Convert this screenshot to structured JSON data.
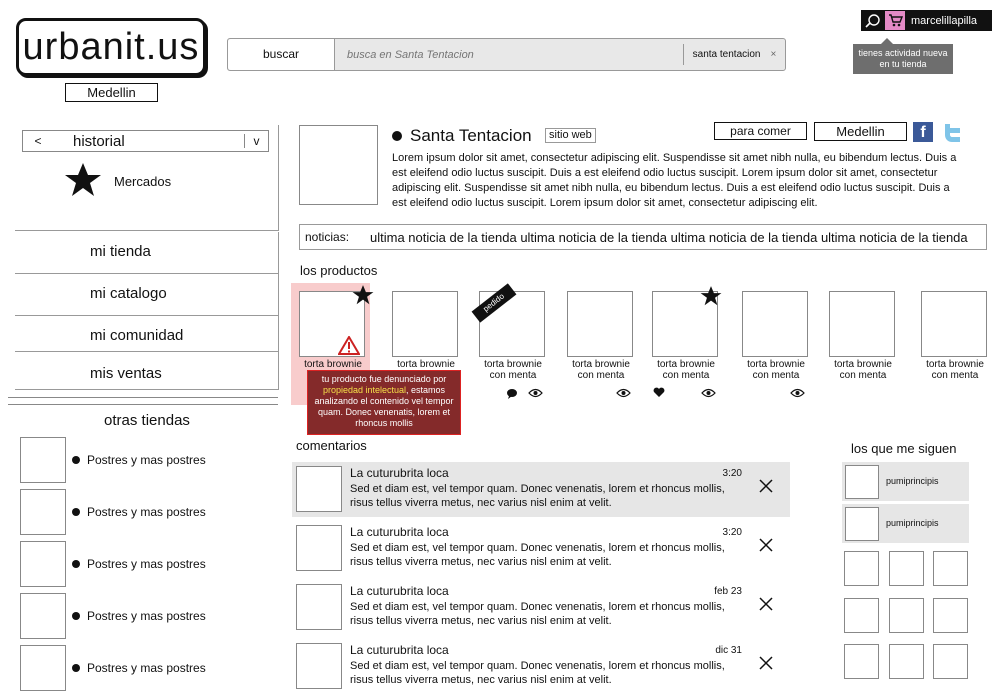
{
  "brand": {
    "logo_text": "urbanit.us",
    "city": "Medellin"
  },
  "search": {
    "button_label": "buscar",
    "placeholder": "busca en Santa Tentacion",
    "scope": "santa tentacion",
    "clear": "×"
  },
  "user": {
    "name": "marcelillapilla",
    "activity_tooltip": "tienes actividad nueva en tu tienda",
    "icons": [
      "chat-icon",
      "cart-icon"
    ]
  },
  "sidebar": {
    "history": {
      "prev": "<",
      "label": "historial",
      "next": "v"
    },
    "featured": {
      "icon": "star-icon",
      "label": "Mercados"
    },
    "nav": [
      "mi tienda",
      "mi catalogo",
      "mi comunidad",
      "mis ventas"
    ],
    "other_stores_title": "otras tiendas",
    "other_stores": [
      "Postres y mas postres",
      "Postres y mas postres",
      "Postres y mas postres",
      "Postres y mas postres",
      "Postres y mas postres"
    ]
  },
  "store": {
    "name": "Santa Tentacion",
    "website_label": "sitio web",
    "category": "para comer",
    "city": "Medellin",
    "social": [
      "facebook-icon",
      "twitter-icon"
    ],
    "description": "Lorem ipsum dolor sit amet, consectetur adipiscing elit. Suspendisse sit amet nibh nulla, eu bibendum lectus. Duis a est eleifend odio luctus suscipit. Duis a est eleifend odio luctus suscipit. Lorem ipsum dolor sit amet, consectetur adipiscing elit. Suspendisse sit amet nibh nulla, eu bibendum lectus. Duis a est eleifend odio luctus suscipit. Duis a est eleifend odio luctus suscipit. Lorem ipsum dolor sit amet, consectetur adipiscing elit."
  },
  "news": {
    "label": "noticias:",
    "text": "ultima noticia de la tienda ultima noticia de la tienda ultima noticia de la tienda ultima noticia de la tienda"
  },
  "products": {
    "title": "los productos",
    "pedido_badge": "pedido",
    "warning": {
      "pre": "tu producto fue denunciado por ",
      "highlight": "propiedad intelectual",
      "post": ", estamos analizando el contenido vel tempor quam. Donec venenatis, lorem et rhoncus mollis"
    },
    "items": [
      {
        "name": "torta brownie con menta",
        "starred": true,
        "flagged": true
      },
      {
        "name": "torta brownie con menta",
        "icons": [
          "comment-icon",
          "eye-icon"
        ]
      },
      {
        "name": "torta brownie con menta",
        "pedido": true,
        "icons": [
          "eye-icon"
        ]
      },
      {
        "name": "torta brownie con menta"
      },
      {
        "name": "torta brownie con menta",
        "starred": true,
        "icons": [
          "heart-icon",
          "eye-icon"
        ]
      },
      {
        "name": "torta brownie con menta",
        "icons": [
          "eye-icon"
        ]
      },
      {
        "name": "torta brownie con menta"
      },
      {
        "name": "torta brownie con menta"
      }
    ]
  },
  "comments": {
    "title": "comentarios",
    "items": [
      {
        "author": "La cuturubrita loca",
        "time": "3:20",
        "text": "Sed et diam est, vel tempor quam. Donec venenatis, lorem et rhoncus mollis, risus tellus viverra metus, nec varius nisl enim at velit.",
        "highlighted": true
      },
      {
        "author": "La cuturubrita loca",
        "time": "3:20",
        "text": "Sed et diam est, vel tempor quam. Donec venenatis, lorem et rhoncus mollis, risus tellus viverra metus, nec varius nisl enim at velit."
      },
      {
        "author": "La cuturubrita loca",
        "time": "feb 23",
        "text": "Sed et diam est, vel tempor quam. Donec venenatis, lorem et rhoncus mollis, risus tellus viverra metus, nec varius nisl enim at velit."
      },
      {
        "author": "La cuturubrita loca",
        "time": "dic 31",
        "text": "Sed et diam est, vel tempor quam. Donec venenatis, lorem et rhoncus mollis, risus tellus viverra metus, nec varius nisl enim at velit."
      }
    ]
  },
  "followers": {
    "title": "los que me siguen",
    "items": [
      "pumiprincipis",
      "pumiprincipis"
    ]
  }
}
